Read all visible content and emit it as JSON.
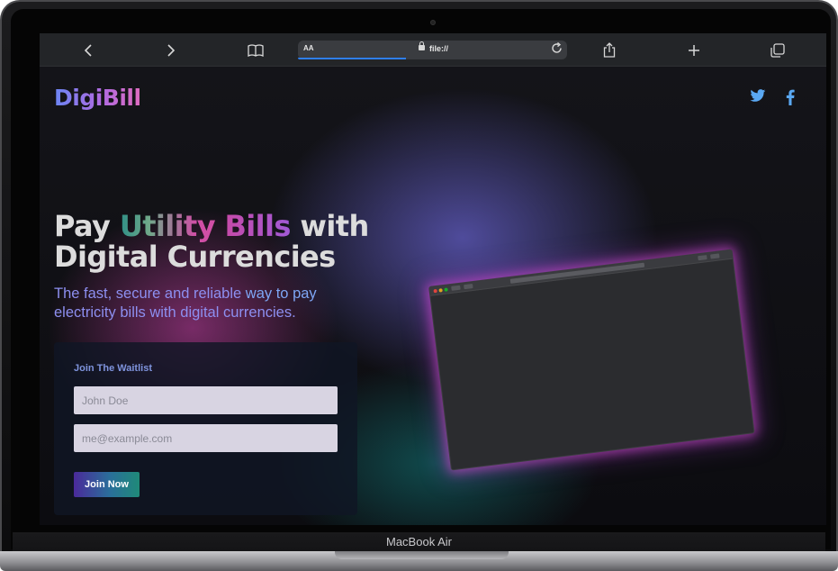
{
  "device": {
    "label": "MacBook Air"
  },
  "browser": {
    "text_size_label": "AA",
    "url": "file://",
    "icons": {
      "back": "chevron-left-icon",
      "forward": "chevron-right-icon",
      "bookmarks": "book-icon",
      "reload": "reload-icon",
      "share": "share-icon",
      "new_tab": "plus-icon",
      "tabs": "tabs-icon"
    }
  },
  "site": {
    "logo": "DigiBill",
    "social": [
      "twitter-icon",
      "facebook-icon"
    ],
    "hero": {
      "title_word1": "Pay",
      "title_word2": "Utility",
      "title_word3": "Bills",
      "title_word4": "with",
      "title_line2": "Digital Currencies",
      "subtitle_part1": "The fast, secure and reliable",
      "subtitle_part2": "way to pay",
      "subtitle_line2": "electricity bills with digital currencies."
    },
    "waitlist": {
      "title": "Join The Waitlist",
      "name_placeholder": "John Doe",
      "email_placeholder": "me@example.com",
      "button_label": "Join Now"
    },
    "colors": {
      "logo_start": "#6b86f5",
      "logo_end": "#e06cc0",
      "subtitle": "#8d8ff0",
      "button_start": "#4a2a9a",
      "button_end": "#1f8a78",
      "mockup_glow": "#c846c8"
    }
  }
}
